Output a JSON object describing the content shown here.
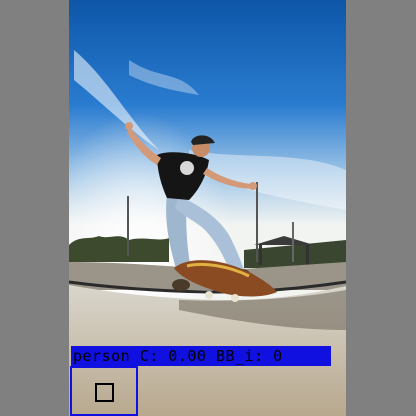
{
  "detection": {
    "label_text": "person C: 0.00 BB_i: 0",
    "box_color": "#1010e0"
  },
  "scene": {
    "subject": "skateboarder-mid-trick",
    "background_color": "#808080"
  }
}
